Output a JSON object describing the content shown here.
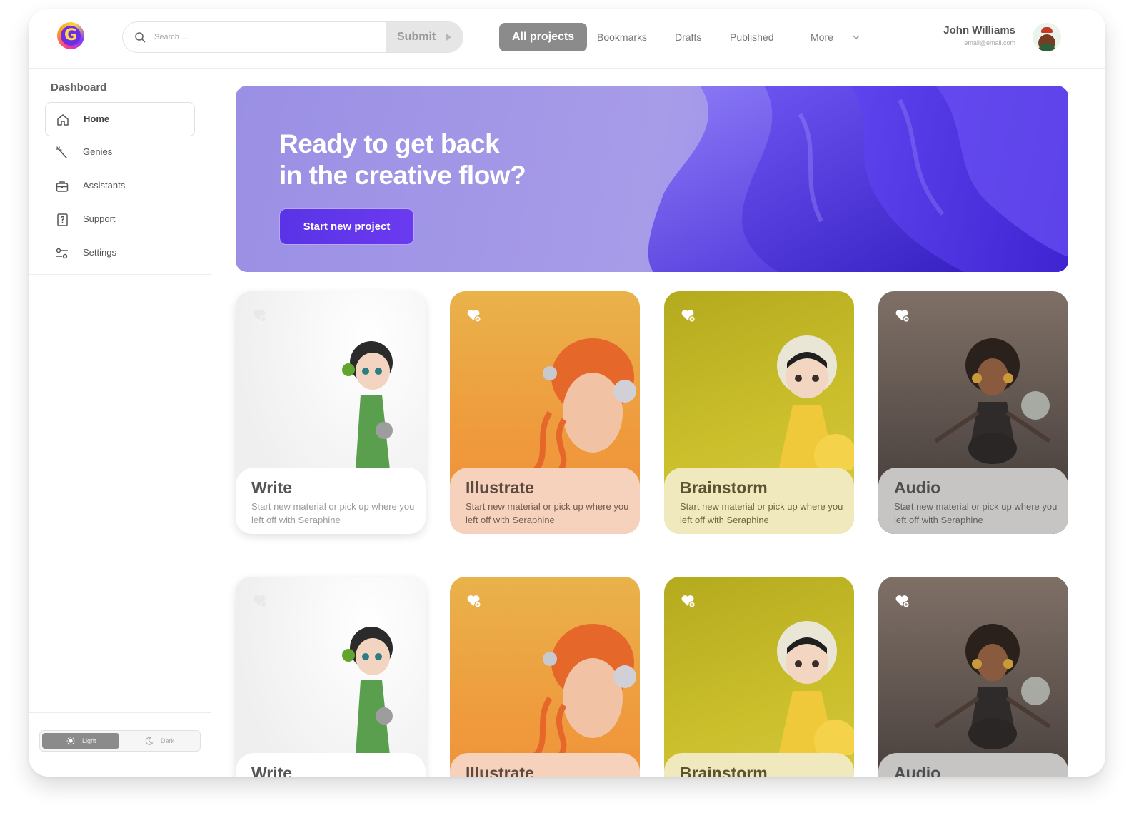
{
  "app": {
    "logo_letter": "G"
  },
  "search": {
    "placeholder": "Search ...",
    "submit_label": "Submit"
  },
  "nav": {
    "tabs": [
      {
        "label": "All projects",
        "active": true
      },
      {
        "label": "Bookmarks"
      },
      {
        "label": "Drafts"
      },
      {
        "label": "Published"
      },
      {
        "label": "More"
      }
    ]
  },
  "user": {
    "name": "John Williams",
    "email": "email@email.com"
  },
  "sidebar": {
    "title": "Dashboard",
    "items": [
      {
        "label": "Home",
        "icon": "home-icon",
        "active": true
      },
      {
        "label": "Genies",
        "icon": "magic-wand-icon"
      },
      {
        "label": "Assistants",
        "icon": "briefcase-icon"
      },
      {
        "label": "Support",
        "icon": "help-book-icon"
      },
      {
        "label": "Settings",
        "icon": "sliders-icon"
      }
    ],
    "theme": {
      "light_label": "Light",
      "dark_label": "Dark",
      "selected": "Light"
    }
  },
  "hero": {
    "title_line1": "Ready to get back",
    "title_line2": "in the creative flow?",
    "cta_label": "Start new project"
  },
  "cards": [
    {
      "title": "Write",
      "description": "Start new material or pick up where you left off with Seraphine",
      "theme": "white"
    },
    {
      "title": "Illustrate",
      "description": "Start new material or pick up where you left off with Seraphine",
      "theme": "orange"
    },
    {
      "title": "Brainstorm",
      "description": "Start new material or pick up where you left off with Seraphine",
      "theme": "yellow"
    },
    {
      "title": "Audio",
      "description": "Start new material or pick up where you left off with Seraphine",
      "theme": "brown"
    }
  ],
  "colors": {
    "accent": "#5b35e8",
    "hero_bg": "#9b90e6",
    "active_tab": "#8b8b8b",
    "card_orange": "#ef9a3c",
    "card_yellow": "#c7bb2a",
    "card_brown": "#5c514c"
  }
}
